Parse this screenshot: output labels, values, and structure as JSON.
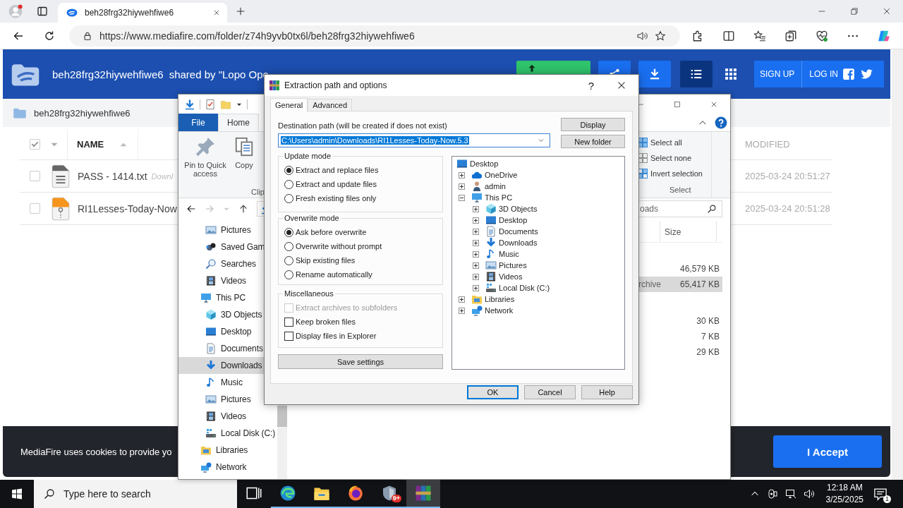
{
  "browser": {
    "tab": {
      "title": "beh28frg32hiywehfiwe6"
    },
    "address": {
      "url": "https://www.mediafire.com/folder/z74h9yvb0tx6l/beh28frg32hiywehfiwe6"
    }
  },
  "mediafire": {
    "header": {
      "folder_name": "beh28frg32hiywehfiwe6",
      "shared_by": "shared by \"Lopo Ope",
      "sign_up": "SIGN UP",
      "log_in": "LOG IN"
    },
    "views": [
      {
        "kind": "list",
        "selected": true
      },
      {
        "kind": "grid",
        "selected": false
      }
    ],
    "breadcrumb": "beh28frg32hiywehfiwe6",
    "select_all": {
      "checked": true
    },
    "columns": {
      "name": "NAME",
      "modified": "MODIFIED"
    },
    "files": [
      {
        "kind": "text",
        "name": "PASS - 1414.txt",
        "note": "Downl",
        "modified": "2025-03-24 20:51:27",
        "checked": false
      },
      {
        "kind": "archive",
        "name": "RI1Lesses-Today-Now",
        "modified": "2025-03-24 20:51:28",
        "checked": false
      }
    ],
    "cookie": {
      "text": "MediaFire uses cookies to provide yo",
      "accept": "I Accept"
    }
  },
  "explorer": {
    "ribbon_tabs": [
      {
        "label": "File",
        "kind": "menu",
        "selected": false
      },
      {
        "label": "Home",
        "kind": "tab",
        "selected": true
      }
    ],
    "clipboard": {
      "commands": [
        {
          "label": "Pin to Quick access",
          "kind": "pin"
        },
        {
          "label": "Copy",
          "kind": "copy"
        }
      ],
      "group_label": "Clip"
    },
    "select": {
      "commands": [
        {
          "label": "Select all",
          "kind": "all"
        },
        {
          "label": "Select none",
          "kind": "none"
        },
        {
          "label": "Invert selection",
          "kind": "invert"
        }
      ],
      "group_label": "Select"
    },
    "search": {
      "placeholder": "oads"
    },
    "nav": {
      "scrolled_children": [
        {
          "label": "Pictures",
          "kind": "pictures",
          "selected": false
        },
        {
          "label": "Saved Gam",
          "kind": "games",
          "selected": false
        },
        {
          "label": "Searches",
          "kind": "searches",
          "selected": false
        },
        {
          "label": "Videos",
          "kind": "videos",
          "selected": false
        }
      ],
      "items": [
        {
          "label": "This PC",
          "kind": "pc",
          "selected": false,
          "children": [
            {
              "label": "3D Objects",
              "kind": "objects",
              "selected": false
            },
            {
              "label": "Desktop",
              "kind": "desktop",
              "selected": false
            },
            {
              "label": "Documents",
              "kind": "documents",
              "selected": false
            },
            {
              "label": "Downloads",
              "kind": "downloads",
              "selected": true
            },
            {
              "label": "Music",
              "kind": "music",
              "selected": false
            },
            {
              "label": "Pictures",
              "kind": "pictures",
              "selected": false
            },
            {
              "label": "Videos",
              "kind": "videos",
              "selected": false
            },
            {
              "label": "Local Disk (C:)",
              "kind": "disk",
              "selected": false
            }
          ]
        },
        {
          "label": "Libraries",
          "kind": "libraries",
          "selected": false
        },
        {
          "label": "Network",
          "kind": "network",
          "selected": false
        }
      ]
    },
    "columns": {
      "size": "Size"
    },
    "rows": [
      {
        "size": "46,579 KB",
        "selected": false
      },
      {
        "type": "rchive",
        "size": "65,417 KB",
        "selected": true
      },
      {
        "size": "30 KB",
        "selected": false
      },
      {
        "size": "7 KB",
        "selected": false
      },
      {
        "size": "29 KB",
        "selected": false
      }
    ]
  },
  "dialog": {
    "title": "Extraction path and options",
    "help": "?",
    "tabs": [
      {
        "label": "General",
        "selected": true
      },
      {
        "label": "Advanced",
        "selected": false
      }
    ],
    "destination_label": "Destination path (will be created if does not exist)",
    "destination_path": "C:\\Users\\admin\\Downloads\\RI1Lesses-Today-Now.5.3",
    "side_buttons": [
      "Display",
      "New folder"
    ],
    "groups": [
      {
        "title": "Update mode",
        "kind": "radio",
        "options": [
          {
            "label": "Extract and replace files",
            "selected": true
          },
          {
            "label": "Extract and update files",
            "selected": false
          },
          {
            "label": "Fresh existing files only",
            "selected": false
          }
        ]
      },
      {
        "title": "Overwrite mode",
        "kind": "radio",
        "options": [
          {
            "label": "Ask before overwrite",
            "selected": true
          },
          {
            "label": "Overwrite without prompt",
            "selected": false
          },
          {
            "label": "Skip existing files",
            "selected": false
          },
          {
            "label": "Rename automatically",
            "selected": false
          }
        ]
      },
      {
        "title": "Miscellaneous",
        "kind": "checkbox",
        "options": [
          {
            "label": "Extract archives to subfolders",
            "checked": false,
            "disabled": true
          },
          {
            "label": "Keep broken files",
            "checked": false,
            "disabled": false
          },
          {
            "label": "Display files in Explorer",
            "checked": false,
            "disabled": false
          }
        ]
      }
    ],
    "save_settings": "Save settings",
    "tree": [
      {
        "label": "Desktop",
        "kind": "desktop",
        "children": [
          {
            "label": "OneDrive",
            "kind": "onedrive",
            "expanded": false
          },
          {
            "label": "admin",
            "kind": "user",
            "expanded": false
          },
          {
            "label": "This PC",
            "kind": "pc",
            "expanded": true,
            "children": [
              {
                "label": "3D Objects",
                "kind": "objects",
                "expanded": false
              },
              {
                "label": "Desktop",
                "kind": "desktop",
                "expanded": false
              },
              {
                "label": "Documents",
                "kind": "documents",
                "expanded": false
              },
              {
                "label": "Downloads",
                "kind": "downloads",
                "expanded": false
              },
              {
                "label": "Music",
                "kind": "music",
                "expanded": false
              },
              {
                "label": "Pictures",
                "kind": "pictures",
                "expanded": false
              },
              {
                "label": "Videos",
                "kind": "videos",
                "expanded": false
              },
              {
                "label": "Local Disk (C:)",
                "kind": "disk",
                "expanded": false
              }
            ]
          },
          {
            "label": "Libraries",
            "kind": "libraries",
            "expanded": false
          },
          {
            "label": "Network",
            "kind": "network",
            "expanded": false
          }
        ]
      }
    ],
    "buttons": [
      {
        "label": "OK",
        "default": true
      },
      {
        "label": "Cancel",
        "default": false
      },
      {
        "label": "Help",
        "default": false
      }
    ]
  },
  "taskbar": {
    "search_placeholder": "Type here to search",
    "apps": [
      {
        "kind": "taskview",
        "running": false,
        "active": false
      },
      {
        "kind": "edge",
        "running": true,
        "active": false
      },
      {
        "kind": "explorer",
        "running": true,
        "active": false
      },
      {
        "kind": "firefox",
        "running": true,
        "active": false
      },
      {
        "kind": "shield",
        "running": true,
        "active": false,
        "badge": "9+"
      },
      {
        "kind": "winrar",
        "running": true,
        "active": true
      }
    ],
    "time": "12:18 AM",
    "date": "3/25/2025",
    "notifications": "1"
  }
}
